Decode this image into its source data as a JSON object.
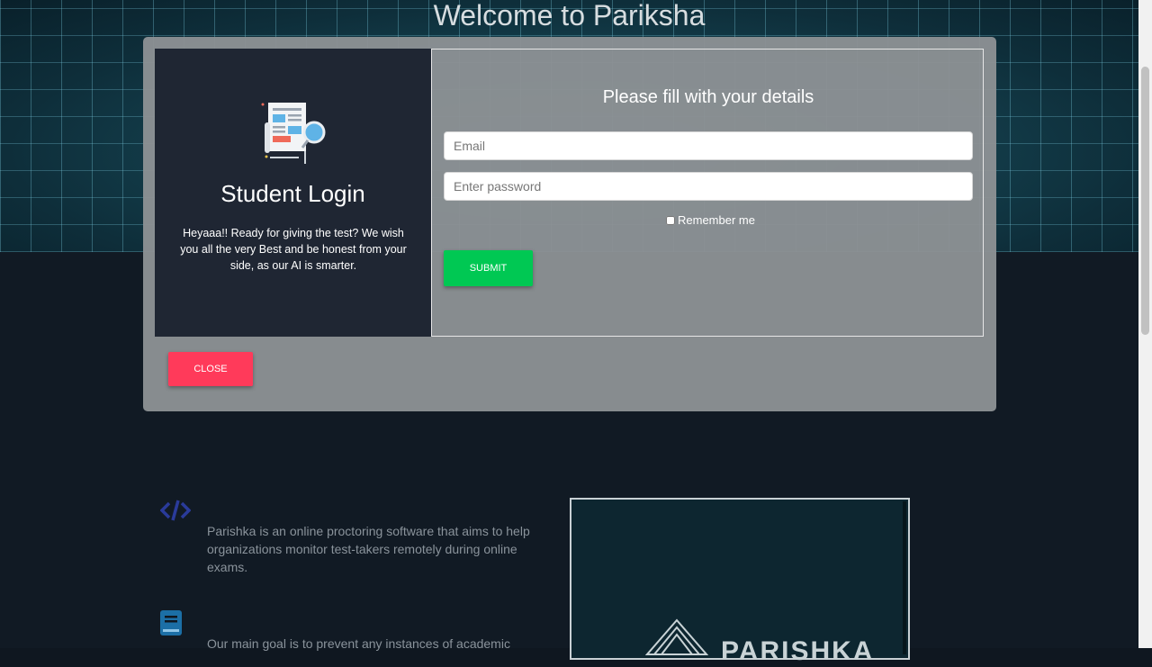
{
  "page": {
    "hero_title": "Welcome to Pariksha",
    "feature1_text": "Parishka is an online proctoring software that aims to help organizations monitor test-takers remotely during online exams.",
    "feature2_text": "Our main goal is to prevent any instances of academic",
    "preview_brand": "PARISHKA"
  },
  "login": {
    "title": "Student Login",
    "description": "Heyaaa!! Ready for giving the test? We wish you all the very Best and be honest from your side, as our AI is smarter."
  },
  "form": {
    "title": "Please fill with your details",
    "email_placeholder": "Email",
    "password_placeholder": "Enter password",
    "remember_label": "Remember me",
    "submit_label": "SUBMIT"
  },
  "modal": {
    "close_label": "CLOSE"
  },
  "colors": {
    "submit": "#00c853",
    "close": "#ff3a5a",
    "login_panel": "#1f2633"
  }
}
